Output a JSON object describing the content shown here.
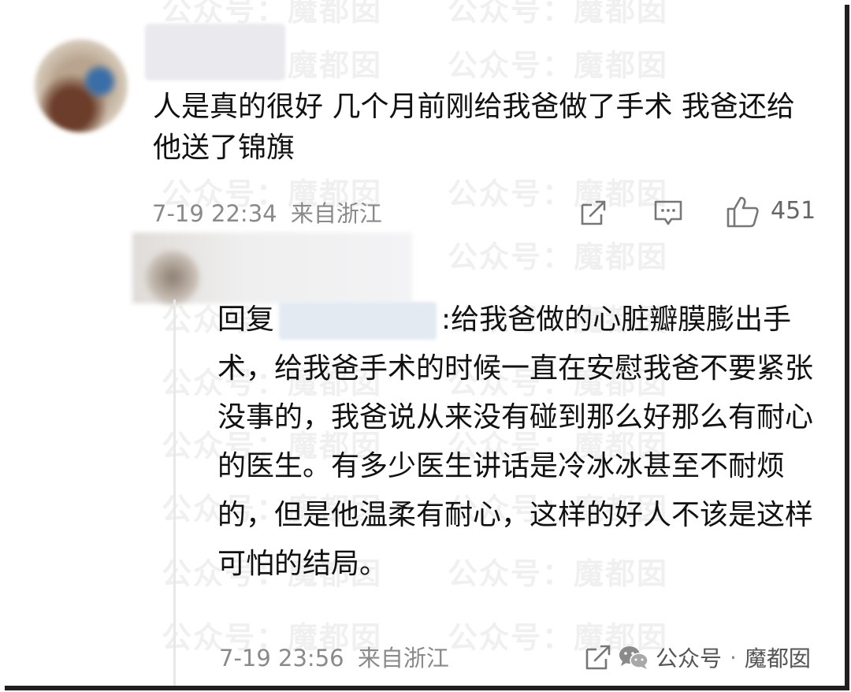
{
  "watermark": "公众号：魔都囡",
  "comment": {
    "text": "人是真的很好 几个月前刚给我爸做了手术 我爸还给他送了锦旗",
    "time": "7-19 22:34",
    "location": "来自浙江",
    "like_count": "451"
  },
  "reply": {
    "prefix": "回复",
    "text": ":给我爸做的心脏瓣膜膨出手术，给我爸手术的时候一直在安慰我爸不要紧张没事的，我爸说从来没有碰到那么好那么有耐心的医生。有多少医生讲话是冷冰冰甚至不耐烦的，但是他温柔有耐心，这样的好人不该是这样可怕的结局。",
    "time": "7-19 23:56",
    "location": "来自浙江"
  },
  "brand": {
    "account": "公众号",
    "dot": "·",
    "name": "魔都囡"
  },
  "icons": {
    "share": "share-icon",
    "reply": "comment-icon",
    "like": "thumbs-up-icon",
    "wechat": "wechat-icon"
  },
  "colors": {
    "text": "#111111",
    "meta": "#8a8a8a",
    "line": "#e8e8e8"
  }
}
